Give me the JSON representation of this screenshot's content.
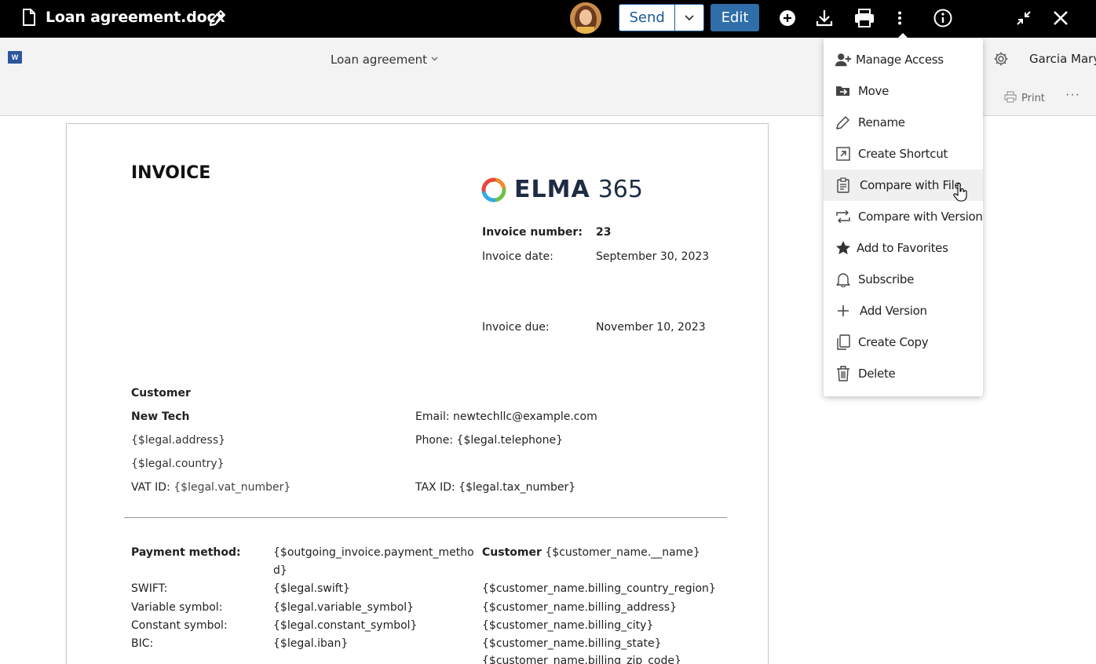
{
  "topbar": {
    "title": "Loan agreement.docx",
    "send_label": "Send",
    "edit_label": "Edit"
  },
  "wordbar": {
    "doc_name": "Loan agreement",
    "user_name": "Garcia Mary",
    "print_label": "Print",
    "more_label": "···"
  },
  "document": {
    "heading": "INVOICE",
    "logo_word": "ELMA",
    "logo_number": "365",
    "invoice_number_label": "Invoice number:",
    "invoice_number_value": "23",
    "invoice_date_label": "Invoice date:",
    "invoice_date_value": "September 30, 2023",
    "invoice_due_label": "Invoice due:",
    "invoice_due_value": "November 10, 2023",
    "customer_heading": "Customer",
    "customer_name": "New Tech",
    "address": "{$legal.address}",
    "country": "{$legal.country}",
    "vat_label": "VAT ID:",
    "vat_value": "{$legal.vat_number}",
    "email": "Email: newtechllc@example.com",
    "phone": "Phone: {$legal.telephone}",
    "tax": "TAX ID: {$legal.tax_number}",
    "payment_method_label": "Payment method:",
    "payment_method_value_1": "{$outgoing_invoice.payment_metho",
    "payment_method_value_2": "d}",
    "swift_label": "SWIFT:",
    "swift_value": "{$legal.swift}",
    "variable_label": "Variable symbol:",
    "variable_value": "{$legal.variable_symbol}",
    "constant_label": "Constant symbol:",
    "constant_value": "{$legal.constant_symbol}",
    "bic_label": "BIC:",
    "bic_value": "{$legal.iban}",
    "customer2_label": "Customer",
    "customer2_value": "{$customer_name.__name}",
    "billing_country": "{$customer_name.billing_country_region}",
    "billing_address": "{$customer_name.billing_address}",
    "billing_city": "{$customer_name.billing_city}",
    "billing_state": "{$customer_name.billing_state}",
    "billing_zip": "{$customer_name.billing_zip_code}"
  },
  "menu": {
    "items": [
      {
        "label": "Manage Access",
        "icon": "add-user-icon"
      },
      {
        "label": "Move",
        "icon": "move-folder-icon"
      },
      {
        "label": "Rename",
        "icon": "pencil-icon"
      },
      {
        "label": "Create Shortcut",
        "icon": "shortcut-icon"
      },
      {
        "label": "Compare with File",
        "icon": "clipboard-icon"
      },
      {
        "label": "Compare with Version",
        "icon": "compare-arrows-icon"
      },
      {
        "label": "Add to Favorites",
        "icon": "star-icon"
      },
      {
        "label": "Subscribe",
        "icon": "bell-icon"
      },
      {
        "label": "Add Version",
        "icon": "plus-icon"
      },
      {
        "label": "Create Copy",
        "icon": "copy-icon"
      },
      {
        "label": "Delete",
        "icon": "trash-icon"
      }
    ]
  },
  "colors": {
    "topbar_bg": "#000000",
    "edit_button": "#2f6ea8",
    "send_text": "#1b5a96",
    "toolbar_bg": "#f3f3f3",
    "menu_hover": "#f0f0f0"
  }
}
